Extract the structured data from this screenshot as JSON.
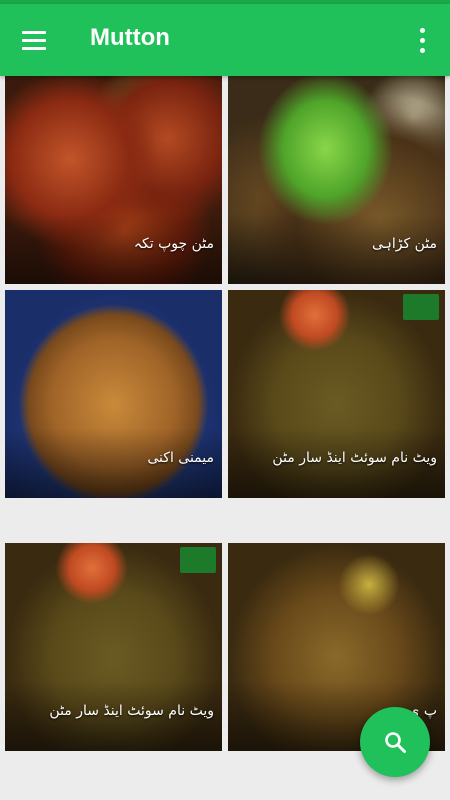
{
  "appbar": {
    "title": "Mutton",
    "menu_icon": "hamburger-menu-icon",
    "overflow_icon": "more-vertical-icon",
    "color": "#20c05a"
  },
  "recipes": [
    {
      "name": "مٹن چوپ تکہ"
    },
    {
      "name": "مٹن کڑاہی"
    },
    {
      "name": "میمنی اکنی"
    },
    {
      "name": "ویٹ نام سوئٹ اینڈ سار مٹن"
    },
    {
      "name": "ویٹ نام سوئٹ اینڈ سار مٹن"
    },
    {
      "name": "پ ی"
    }
  ],
  "fab": {
    "icon": "search-icon"
  }
}
